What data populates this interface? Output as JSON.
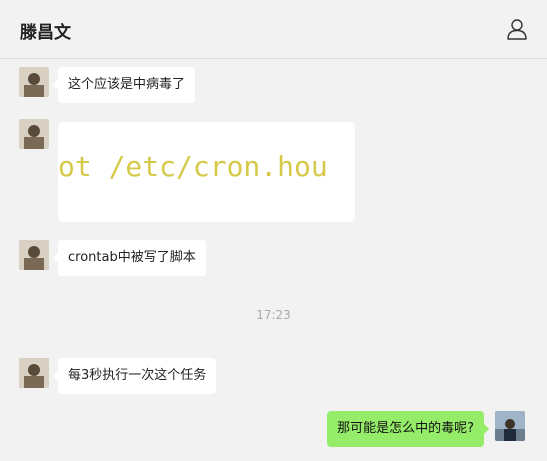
{
  "header": {
    "title": "滕昌文",
    "profile_icon": "person-icon"
  },
  "messages": [
    {
      "side": "left",
      "text": "这个应该是中病毒了"
    },
    {
      "side": "left",
      "type": "image",
      "image_text": "ot /etc/cron.hou"
    },
    {
      "side": "left",
      "text": "crontab中被写了脚本"
    },
    {
      "side": "left",
      "text": "每3秒执行一次这个任务"
    },
    {
      "side": "right",
      "text": "那可能是怎么中的毒呢?"
    }
  ],
  "timestamp": "17:23",
  "colors": {
    "background": "#f2f2f2",
    "incoming_bubble": "#ffffff",
    "outgoing_bubble": "#95ec69",
    "image_text": "#d6c94a"
  }
}
